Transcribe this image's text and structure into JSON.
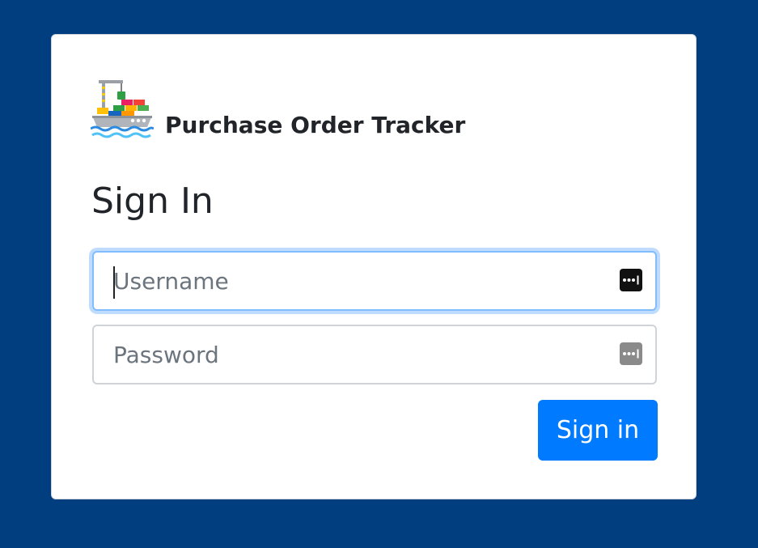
{
  "app": {
    "title": "Purchase Order Tracker",
    "logo_icon": "cargo-ship-icon"
  },
  "form": {
    "heading": "Sign In",
    "username": {
      "placeholder": "Username",
      "value": "",
      "focused": true,
      "autofill_icon": "password-manager-icon"
    },
    "password": {
      "placeholder": "Password",
      "value": "",
      "autofill_icon": "password-manager-icon"
    },
    "submit_label": "Sign in"
  },
  "colors": {
    "background": "#003e80",
    "card": "#ffffff",
    "primary_button": "#007bff",
    "focus_ring": "#80bdff"
  }
}
